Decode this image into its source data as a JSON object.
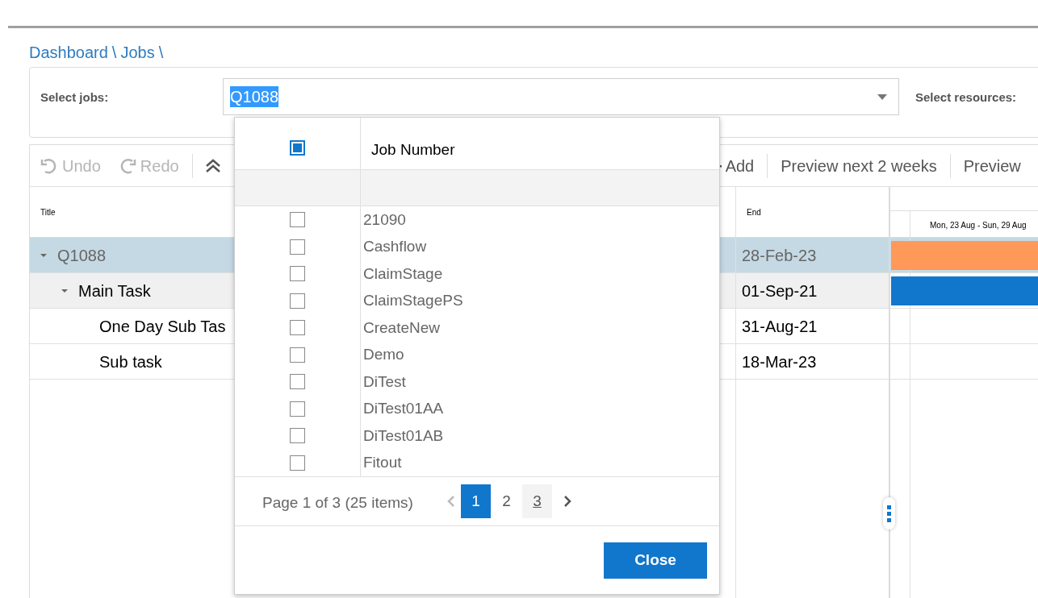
{
  "breadcrumb": [
    {
      "label": "Dashboard",
      "separator": "\\"
    },
    {
      "label": "Jobs",
      "separator": "\\"
    }
  ],
  "filters": {
    "jobs_label": "Select jobs:",
    "jobs_value": "Q1088",
    "resources_label": "Select resources:"
  },
  "toolbar": [
    {
      "kind": "undo",
      "label": "Undo",
      "disabled": true
    },
    {
      "kind": "redo",
      "label": "Redo",
      "disabled": true
    },
    {
      "kind": "collapse",
      "disabled": false
    },
    {
      "kind": "add",
      "label": "Add",
      "disabled": false
    },
    {
      "kind": "text",
      "label": "Preview next 2 weeks",
      "disabled": false
    },
    {
      "kind": "text",
      "label": "Preview",
      "disabled": false
    }
  ],
  "grid": {
    "columns": [
      "Title",
      "End"
    ],
    "timeline_header": "Mon, 23 Aug - Sun, 29 Aug",
    "rows": [
      {
        "title": "Q1088",
        "end": "28-Feb-23",
        "selected": true,
        "hovered": false,
        "expanded": true,
        "bar": {
          "color": "#ff9959"
        },
        "children": [
          {
            "title": "Main Task",
            "end": "01-Sep-21",
            "selected": false,
            "hovered": true,
            "expanded": true,
            "bar": {
              "color": "#1177cc"
            },
            "children": [
              {
                "title": "One Day Sub Tas",
                "end": "31-Aug-21",
                "selected": false,
                "hovered": false
              },
              {
                "title": "Sub task",
                "end": "18-Mar-23",
                "selected": false,
                "hovered": false
              }
            ]
          }
        ]
      }
    ]
  },
  "popup": {
    "header_checkbox": {
      "indeterminate": true
    },
    "column": "Job Number",
    "items": [
      {
        "label": "21090",
        "checked": false
      },
      {
        "label": "Cashflow",
        "checked": false
      },
      {
        "label": "ClaimStage",
        "checked": false
      },
      {
        "label": "ClaimStagePS",
        "checked": false
      },
      {
        "label": "CreateNew",
        "checked": false
      },
      {
        "label": "Demo",
        "checked": false
      },
      {
        "label": "DiTest",
        "checked": false
      },
      {
        "label": "DiTest01AA",
        "checked": false
      },
      {
        "label": "DiTest01AB",
        "checked": false
      },
      {
        "label": "Fitout",
        "checked": false
      }
    ],
    "pager": {
      "info": "Page 1 of 3 (25 items)",
      "prev_disabled": true,
      "pages": [
        {
          "label": "1",
          "selected": true,
          "hovered": false
        },
        {
          "label": "2",
          "selected": false,
          "hovered": false
        },
        {
          "label": "3",
          "selected": false,
          "hovered": true
        }
      ]
    },
    "close": "Close"
  }
}
